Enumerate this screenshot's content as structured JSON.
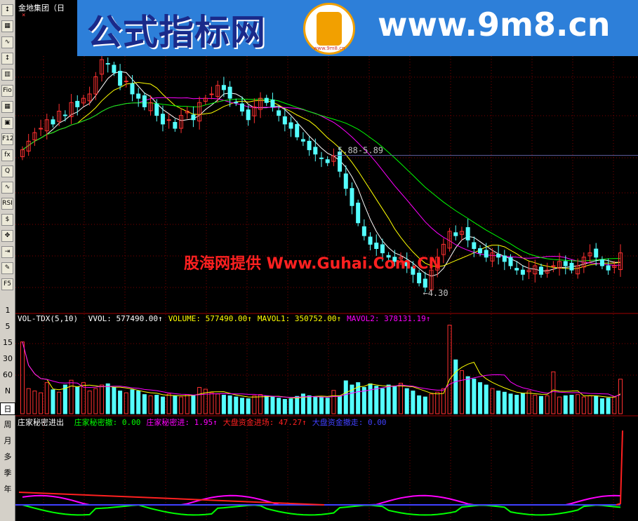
{
  "stock_title": "金地集团（日",
  "banner": {
    "site_name": "公式指标网",
    "url": "www.9m8.cn",
    "logo_sub": "www.9m8.cn"
  },
  "watermark": "股海网提供 Www.Guhai.Com.CN",
  "toolbar": {
    "icons": [
      "↕",
      "▦",
      "∿",
      "↕",
      "▥",
      "Fio",
      "▦",
      "▣",
      "F12",
      "fx",
      "Q",
      "∿",
      "RSI",
      "$",
      "✥",
      "⇥",
      "✎",
      "F5"
    ],
    "text_items": [
      "1",
      "5",
      "15",
      "30",
      "60",
      "N",
      "日",
      "周",
      "月",
      "多",
      "季",
      "年"
    ],
    "active_text": "日"
  },
  "annotations": {
    "resistance": "5.88-5.89",
    "low": "←4.30"
  },
  "vol_header": {
    "name": "VOL-TDX(5,10)",
    "items": [
      {
        "label": "VVOL:",
        "value": "577490.00↑",
        "color": "#ffffff"
      },
      {
        "label": "VOLUME:",
        "value": "577490.00↑",
        "color": "#ffff00"
      },
      {
        "label": "MAVOL1:",
        "value": "350752.00↑",
        "color": "#ffff00"
      },
      {
        "label": "MAVOL2:",
        "value": "378131.19↑",
        "color": "#ff00ff"
      }
    ]
  },
  "ind_header": {
    "name": "庄家秘密进出",
    "items": [
      {
        "label": "庄家秘密撤:",
        "value": "0.00",
        "color": "#00ff00"
      },
      {
        "label": "庄家秘密进:",
        "value": "1.95↑",
        "color": "#ff00ff"
      },
      {
        "label": "大盘资金进场:",
        "value": "47.27↑",
        "color": "#ff2020"
      },
      {
        "label": "大盘资金撤走:",
        "value": "0.00",
        "color": "#4040ff"
      }
    ]
  },
  "chart_data": {
    "type": "candlestick",
    "colors": {
      "up": "#ff3030",
      "down": "#54ffff",
      "ma1": "#ffffff",
      "ma2": "#ffff00",
      "ma3": "#ff00ff",
      "ma4": "#00ff00",
      "grid": "#800000"
    },
    "price_range": [
      4.2,
      7.0
    ],
    "resistance_level": 5.885,
    "low_price": 4.3,
    "closes": [
      5.95,
      6.05,
      6.15,
      6.2,
      6.3,
      6.25,
      6.4,
      6.35,
      6.5,
      6.45,
      6.55,
      6.6,
      6.8,
      7.0,
      6.95,
      6.85,
      6.7,
      6.75,
      6.6,
      6.55,
      6.45,
      6.5,
      6.35,
      6.25,
      6.3,
      6.2,
      6.35,
      6.4,
      6.3,
      6.5,
      6.55,
      6.6,
      6.7,
      6.65,
      6.55,
      6.5,
      6.4,
      6.3,
      6.45,
      6.55,
      6.5,
      6.45,
      6.35,
      6.25,
      6.2,
      6.1,
      6.05,
      5.95,
      5.9,
      5.85,
      5.8,
      5.88,
      5.7,
      5.5,
      5.3,
      5.1,
      4.95,
      4.85,
      4.8,
      4.75,
      4.7,
      4.65,
      4.7,
      4.6,
      4.5,
      4.4,
      4.35,
      4.55,
      4.7,
      4.85,
      5.0,
      4.95,
      5.0,
      4.9,
      4.8,
      4.75,
      4.7,
      4.75,
      4.7,
      4.65,
      4.6,
      4.55,
      4.5,
      4.55,
      4.6,
      4.5,
      4.55,
      4.6,
      4.65,
      4.6,
      4.55,
      4.6,
      4.7,
      4.75,
      4.7,
      4.6,
      4.55,
      4.6,
      4.75
    ],
    "volume_range": [
      0,
      1500000
    ],
    "volumes": [
      1200000,
      420000,
      380000,
      350000,
      520000,
      400000,
      360000,
      480000,
      560000,
      450000,
      520000,
      380000,
      420000,
      480000,
      500000,
      440000,
      380000,
      350000,
      400000,
      380000,
      320000,
      300000,
      310000,
      280000,
      330000,
      300000,
      280000,
      320000,
      300000,
      440000,
      410000,
      350000,
      330000,
      310000,
      300000,
      280000,
      260000,
      250000,
      300000,
      320000,
      300000,
      280000,
      260000,
      240000,
      250000,
      290000,
      330000,
      300000,
      280000,
      270000,
      260000,
      390000,
      300000,
      550000,
      480000,
      520000,
      440000,
      500000,
      460000,
      420000,
      480000,
      460000,
      510000,
      420000,
      380000,
      300000,
      280000,
      330000,
      360000,
      420000,
      1480000,
      900000,
      720000,
      620000,
      580000,
      520000,
      480000,
      420000,
      380000,
      360000,
      330000,
      310000,
      340000,
      380000,
      310000,
      290000,
      300000,
      700000,
      280000,
      300000,
      310000,
      320000,
      280000,
      300000,
      290000,
      250000,
      260000,
      280000,
      577490
    ],
    "mavol1_last": 350752.0,
    "mavol2_last": 378131.19,
    "indicator": {
      "red_series_last": 47.27,
      "magenta_last": 1.95,
      "green_last": 0.0,
      "blue_last": 0.0
    }
  }
}
